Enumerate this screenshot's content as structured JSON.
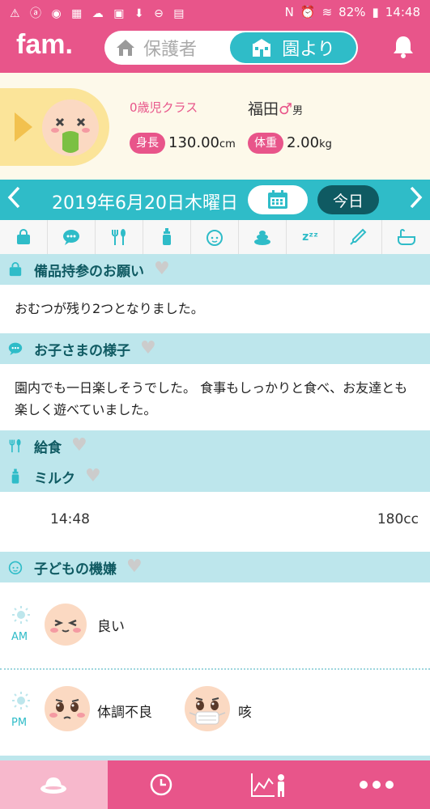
{
  "status_bar": {
    "battery": "82%",
    "time": "14:48"
  },
  "header": {
    "logo": "fam.",
    "tab_parent": "保護者",
    "tab_school": "園より"
  },
  "profile": {
    "class_label": "0歳児クラス",
    "name": "福田",
    "gender_symbol": "♂",
    "gender_label": "男",
    "height_label": "身長",
    "height_value": "130.00",
    "height_unit": "cm",
    "weight_label": "体重",
    "weight_value": "2.00",
    "weight_unit": "kg"
  },
  "date_bar": {
    "date": "2019年6月20日木曜日",
    "today_label": "今日"
  },
  "category_icons": [
    "bag-icon",
    "speech-bubble-icon",
    "utensils-icon",
    "bottle-icon",
    "face-icon",
    "poop-icon",
    "sleep-icon",
    "thermometer-icon",
    "bath-icon"
  ],
  "sections": {
    "items": {
      "title": "備品持参のお願い",
      "body": "おむつが残り2つとなりました。"
    },
    "child_status": {
      "title": "お子さまの様子",
      "body": "園内でも一日楽しそうでした。 食事もしっかりと食べ、お友達とも楽しく遊べていました。"
    },
    "meal": {
      "title": "給食"
    },
    "milk": {
      "title": "ミルク",
      "time": "14:48",
      "amount": "180cc"
    },
    "mood": {
      "title": "子どもの機嫌",
      "am_label": "AM",
      "am_mood": "良い",
      "pm_label": "PM",
      "pm_mood_1": "体調不良",
      "pm_mood_2": "咳"
    }
  },
  "colors": {
    "brand_pink": "#e8558a",
    "teal": "#2fbcc8",
    "dark_teal": "#0f5a62",
    "section_bg": "#bde6ec"
  }
}
